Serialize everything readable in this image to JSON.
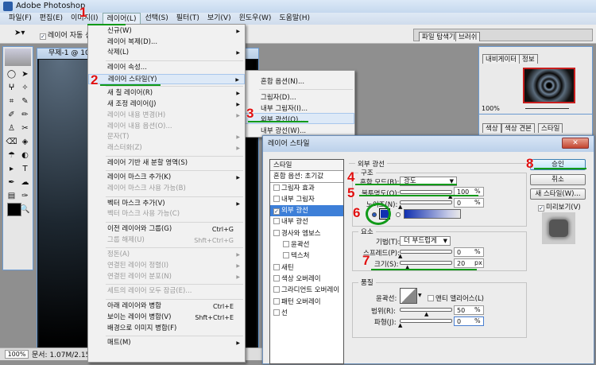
{
  "app": {
    "title": "Adobe Photoshop"
  },
  "menubar": [
    "파일(F)",
    "편집(E)",
    "이미지(I)",
    "레이어(L)",
    "선택(S)",
    "필터(T)",
    "보기(V)",
    "윈도우(W)",
    "도움말(H)"
  ],
  "options_bar": {
    "auto_select_label": "레이어 자동 선택"
  },
  "document": {
    "title": "무제-1 @ 100",
    "zoom": "100%",
    "doc_info": "문서: 1.07M/2.15M"
  },
  "layer_menu": [
    {
      "label": "신규(W)",
      "arrow": true
    },
    {
      "label": "레이어 복제(D)..."
    },
    {
      "label": "삭제(L)",
      "arrow": true
    },
    {
      "sep": true
    },
    {
      "label": "레이어 속성..."
    },
    {
      "label": "레이어 스타일(Y)",
      "arrow": true,
      "hl": true
    },
    {
      "sep": true
    },
    {
      "label": "새 칠 레이어(R)",
      "arrow": true
    },
    {
      "label": "새 조정 레이어(J)",
      "arrow": true
    },
    {
      "label": "레이어 내용 변경(H)",
      "arrow": true,
      "dis": true
    },
    {
      "label": "레이어 내용 옵션(O)...",
      "dis": true
    },
    {
      "label": "문자(T)",
      "arrow": true,
      "dis": true
    },
    {
      "label": "래스터화(Z)",
      "arrow": true,
      "dis": true
    },
    {
      "sep": true
    },
    {
      "label": "레이어 기반 새 분할 영역(S)"
    },
    {
      "sep": true
    },
    {
      "label": "레이어 마스크 추가(K)",
      "arrow": true
    },
    {
      "label": "레이어 마스크 사용 가능(B)",
      "dis": true
    },
    {
      "sep": true
    },
    {
      "label": "벡터 마스크 추가(V)",
      "arrow": true
    },
    {
      "label": "벡터 마스크 사용 가능(C)",
      "dis": true
    },
    {
      "sep": true
    },
    {
      "label": "이전 레이어와 그룹(G)",
      "sc": "Ctrl+G"
    },
    {
      "label": "그룹 해제(U)",
      "sc": "Shft+Ctrl+G",
      "dis": true
    },
    {
      "sep": true
    },
    {
      "label": "정돈(A)",
      "arrow": true,
      "dis": true
    },
    {
      "label": "연결된 레이어 정렬(I)",
      "arrow": true,
      "dis": true
    },
    {
      "label": "연결된 레이어 분포(N)",
      "arrow": true,
      "dis": true
    },
    {
      "sep": true
    },
    {
      "label": "세트의 레이어 모두 잠금(E)...",
      "dis": true
    },
    {
      "sep": true
    },
    {
      "label": "아래 레이어와 병합",
      "sc": "Ctrl+E"
    },
    {
      "label": "보이는 레이어 병합(V)",
      "sc": "Shft+Ctrl+E"
    },
    {
      "label": "배경으로 이미지 병합(F)"
    },
    {
      "sep": true
    },
    {
      "label": "매트(M)",
      "arrow": true
    }
  ],
  "style_submenu": [
    "혼합 옵션(N)...",
    "그림자(D)...",
    "내부 그림자(I)...",
    "외부 광선(O)...",
    "내부 광선(W)..."
  ],
  "panels": {
    "tabs_top": [
      "파일 탐색기",
      "브러쉬"
    ],
    "nav_tabs": [
      "내비게이터",
      "정보"
    ],
    "nav_zoom": "100%",
    "color_tabs": [
      "색상",
      "색상 견본",
      "스타일"
    ]
  },
  "dialog": {
    "title": "레이어 스타일",
    "styles_header": "스타일",
    "styles": [
      {
        "label": "혼합 옵션: 초기값",
        "check": null
      },
      {
        "label": "그림자 효과",
        "check": false
      },
      {
        "label": "내부 그림자",
        "check": false
      },
      {
        "label": "외부 광선",
        "check": true,
        "sel": true
      },
      {
        "label": "내부 광선",
        "check": false
      },
      {
        "label": "경사와 엠보스",
        "check": false
      },
      {
        "label": "윤곽선",
        "check": false,
        "indent": true
      },
      {
        "label": "텍스처",
        "check": false,
        "indent": true
      },
      {
        "label": "새틴",
        "check": false
      },
      {
        "label": "색상 오버레이",
        "check": false
      },
      {
        "label": "그라디언트 오버레이",
        "check": false
      },
      {
        "label": "패턴 오버레이",
        "check": false
      },
      {
        "label": "선",
        "check": false
      }
    ],
    "section": "외부 광선",
    "structure": {
      "title": "구조",
      "blend_mode_label": "혼합 모드(B):",
      "blend_mode": "광도",
      "opacity_label": "불투명도(O):",
      "opacity": "100",
      "noise_label": "노이즈(N):",
      "noise": "0",
      "unit": "%"
    },
    "elements": {
      "title": "요소",
      "technique_label": "기법(T):",
      "technique": "더 부드럽게",
      "spread_label": "스프레드(P):",
      "spread": "0",
      "size_label": "크기(S):",
      "size": "20",
      "size_unit": "px"
    },
    "quality": {
      "title": "품질",
      "contour_label": "윤곽선:",
      "antialias_label": "앤티 앨리어스(L)",
      "range_label": "범위(R):",
      "range": "50",
      "jitter_label": "파형(J):",
      "jitter": "0"
    },
    "buttons": {
      "ok": "승인",
      "cancel": "취소",
      "new_style": "새 스타일(W)...",
      "preview": "미리보기(V)"
    },
    "glow_color": "#1030b0"
  },
  "annotations": [
    "1",
    "2",
    "3",
    "4",
    "5",
    "6",
    "7",
    "8"
  ]
}
